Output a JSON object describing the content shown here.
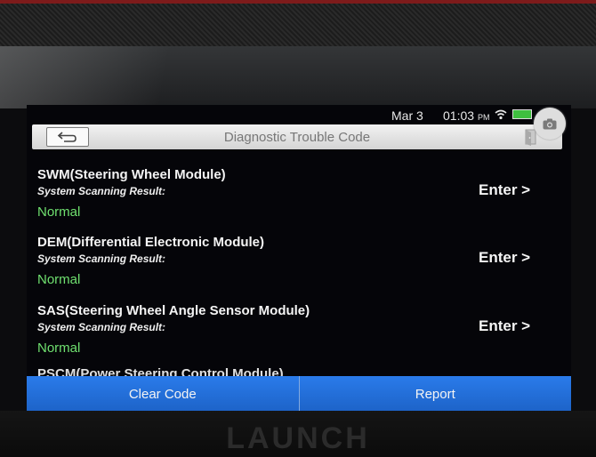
{
  "device": {
    "brand": "LAUNCH"
  },
  "status_bar": {
    "date": "Mar 3",
    "time": "01:03",
    "ampm": "PM"
  },
  "header": {
    "title": "Diagnostic Trouble Code"
  },
  "modules": [
    {
      "name": "SWM(Steering Wheel Module)",
      "subtitle": "System Scanning Result:",
      "result": "Normal",
      "action": "Enter >"
    },
    {
      "name": "DEM(Differential Electronic Module)",
      "subtitle": "System Scanning Result:",
      "result": "Normal",
      "action": "Enter >"
    },
    {
      "name": "SAS(Steering Wheel Angle Sensor Module)",
      "subtitle": "System Scanning Result:",
      "result": "Normal",
      "action": "Enter >"
    }
  ],
  "partial_module": {
    "name": "PSCM(Power Steering Control Module)"
  },
  "footer": {
    "clear_label": "Clear Code",
    "report_label": "Report"
  },
  "colors": {
    "ok": "#6fe06f",
    "button": "#1d63c8",
    "titlebar": "#d4d4d4"
  }
}
